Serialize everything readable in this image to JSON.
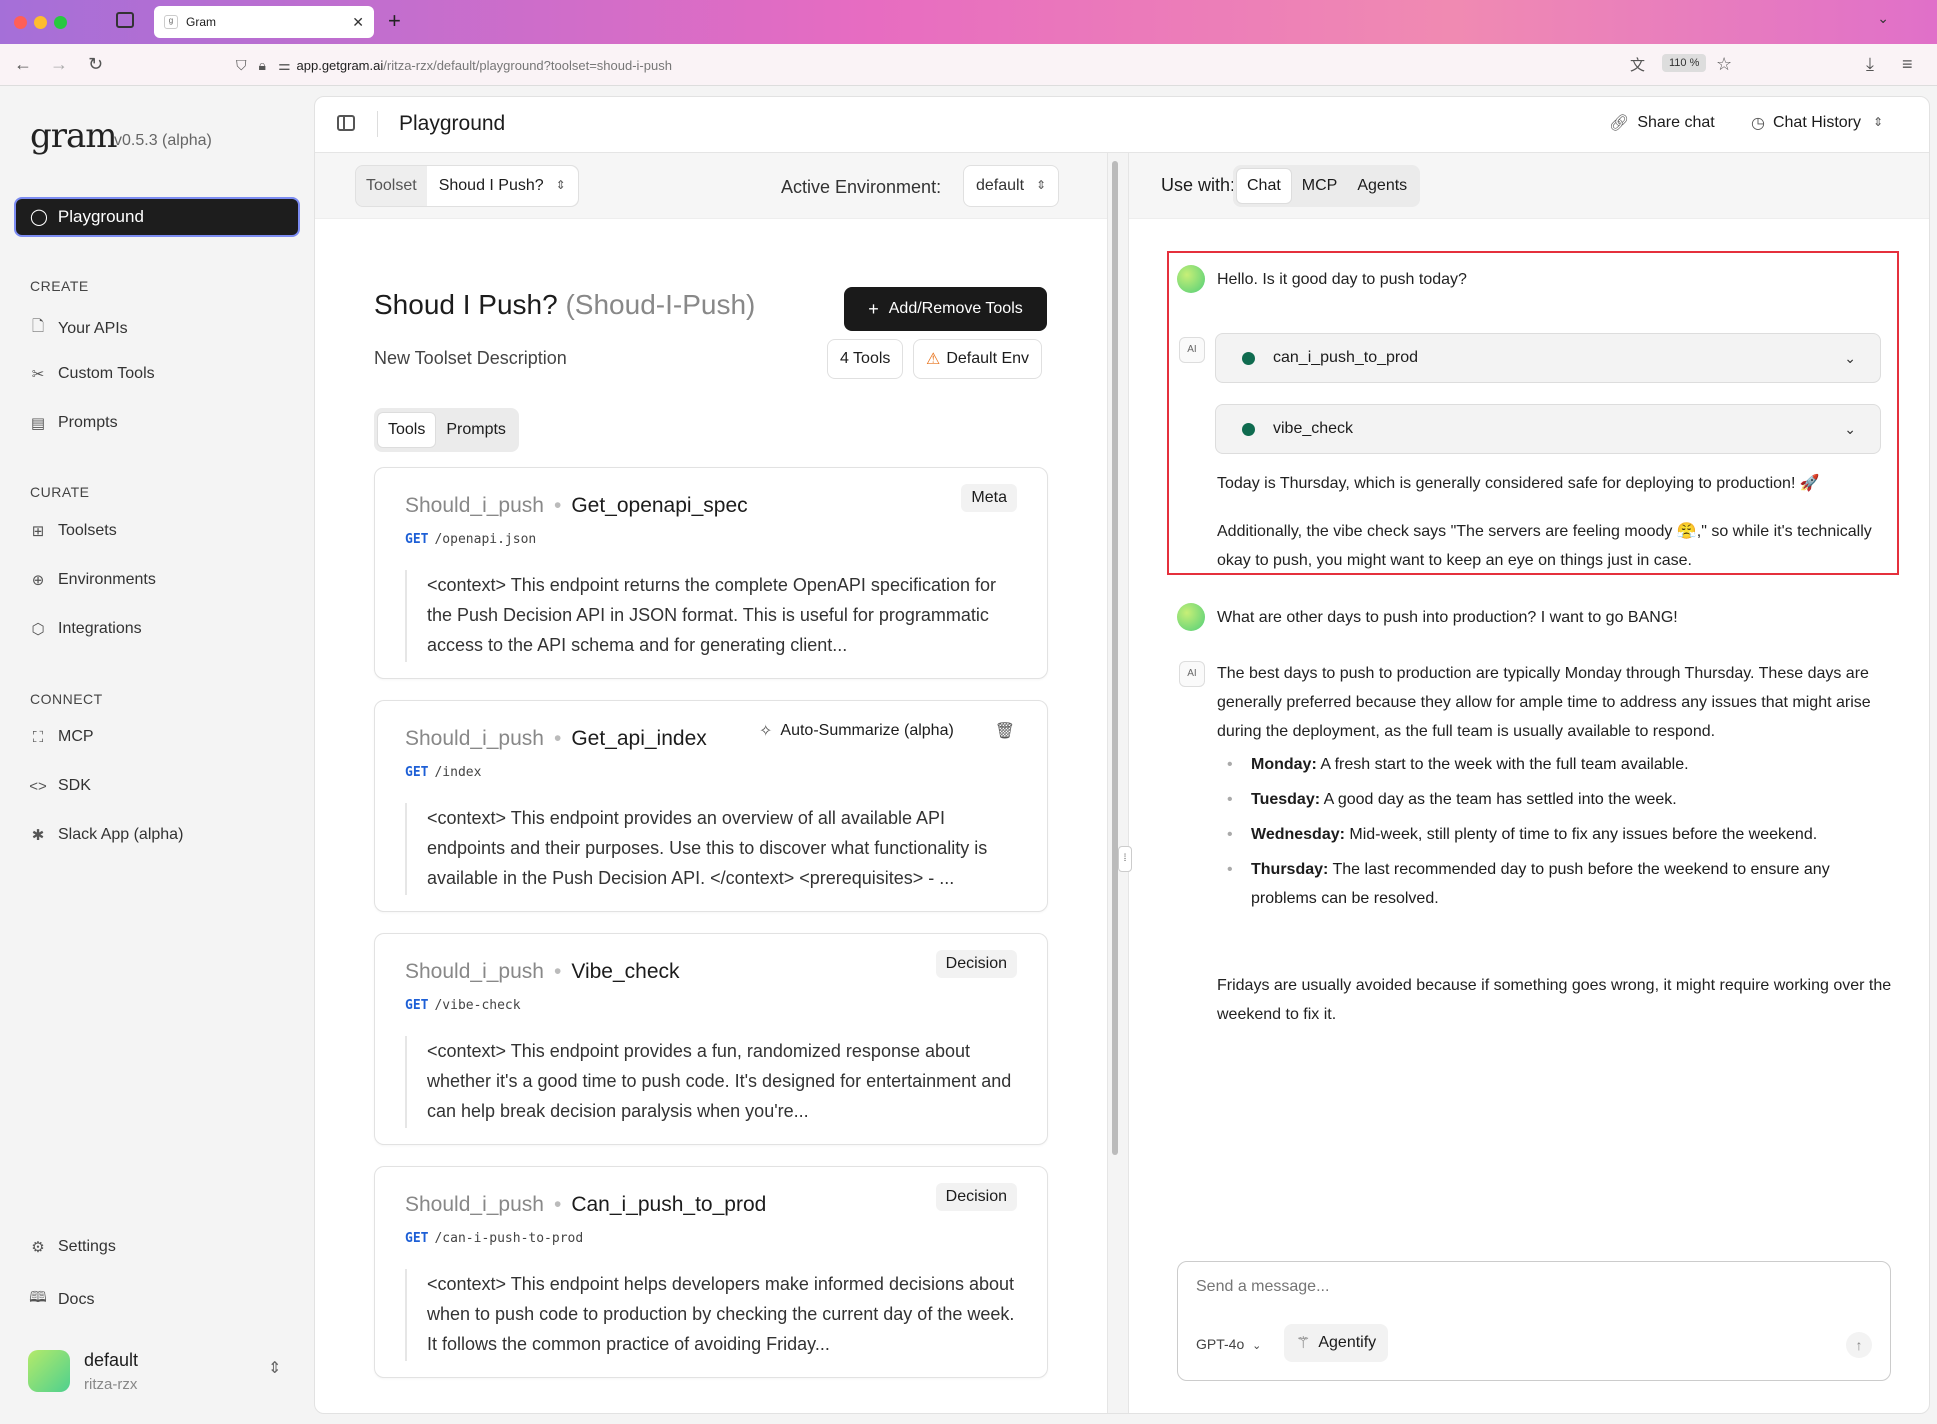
{
  "browser": {
    "tab_title": "Gram",
    "url_host": "app.getgram.ai",
    "url_path": "/ritza-rzx/default/playground?toolset=shoud-i-push",
    "zoom": "110 %"
  },
  "sidebar": {
    "logo": "gram",
    "version": "v0.5.3 (alpha)",
    "active": "Playground",
    "sections": {
      "create": "CREATE",
      "curate": "CURATE",
      "connect": "CONNECT"
    },
    "create_items": [
      "Your APIs",
      "Custom Tools",
      "Prompts"
    ],
    "curate_items": [
      "Toolsets",
      "Environments",
      "Integrations"
    ],
    "connect_items": [
      "MCP",
      "SDK",
      "Slack App (alpha)"
    ],
    "settings": "Settings",
    "docs": "Docs",
    "profile": {
      "name": "default",
      "org": "ritza-rzx"
    }
  },
  "header": {
    "title": "Playground",
    "share": "Share chat",
    "history": "Chat History"
  },
  "left": {
    "toolset_label": "Toolset",
    "toolset_value": "Shoud I Push?",
    "env_label": "Active Environment:",
    "env_value": "default",
    "toolset_name": "Shoud I Push?",
    "toolset_slug": "(Shoud-I-Push)",
    "add_button": "Add/Remove Tools",
    "description": "New Toolset Description",
    "tools_count": "4 Tools",
    "default_env": "Default Env",
    "tabs": [
      "Tools",
      "Prompts"
    ],
    "cards": [
      {
        "source": "Should_i_push",
        "name": "Get_openapi_spec",
        "method": "GET",
        "path": "/openapi.json",
        "badge": "Meta",
        "desc": "<context> This endpoint returns the complete OpenAPI specification for the Push Decision API in JSON format. This is useful for programmatic access to the API schema and for generating client..."
      },
      {
        "source": "Should_i_push",
        "name": "Get_api_index",
        "method": "GET",
        "path": "/index",
        "autosum": "Auto-Summarize (alpha)",
        "desc": "<context> This endpoint provides an overview of all available API endpoints and their purposes. Use this to discover what functionality is available in the Push Decision API. </context> <prerequisites> - ..."
      },
      {
        "source": "Should_i_push",
        "name": "Vibe_check",
        "method": "GET",
        "path": "/vibe-check",
        "badge": "Decision",
        "desc": "<context> This endpoint provides a fun, randomized response about whether it's a good time to push code. It's designed for entertainment and can help break decision paralysis when you're..."
      },
      {
        "source": "Should_i_push",
        "name": "Can_i_push_to_prod",
        "method": "GET",
        "path": "/can-i-push-to-prod",
        "badge": "Decision",
        "desc": "<context> This endpoint helps developers make informed decisions about when to push code to production by checking the current day of the week. It follows the common practice of avoiding Friday..."
      }
    ]
  },
  "right": {
    "use_with": "Use with:",
    "modes": [
      "Chat",
      "MCP",
      "Agents"
    ],
    "ai_label": "AI",
    "msg1": "Hello. Is it good day to push today?",
    "tool1": "can_i_push_to_prod",
    "tool2": "vibe_check",
    "reply1a": "Today is Thursday, which is generally considered safe for deploying to production! 🚀",
    "reply1b": "Additionally, the vibe check says \"The servers are feeling moody 😤,\" so while it's technically okay to push, you might want to keep an eye on things just in case.",
    "msg2": "What are other days to push into production? I want to go BANG!",
    "reply2": "The best days to push to production are typically Monday through Thursday. These days are generally preferred because they allow for ample time to address any issues that might arise during the deployment, as the full team is usually available to respond.",
    "bullets": [
      {
        "day": "Monday:",
        "text": " A fresh start to the week with the full team available."
      },
      {
        "day": "Tuesday:",
        "text": " A good day as the team has settled into the week."
      },
      {
        "day": "Wednesday:",
        "text": " Mid-week, still plenty of time to fix any issues before the weekend."
      },
      {
        "day": "Thursday:",
        "text": " The last recommended day to push before the weekend to ensure any problems can be resolved."
      }
    ],
    "reply2_end": "Fridays are usually avoided because if something goes wrong, it might require working over the weekend to fix it.",
    "composer_placeholder": "Send a message...",
    "model": "GPT-4o",
    "agentify": "Agentify"
  }
}
